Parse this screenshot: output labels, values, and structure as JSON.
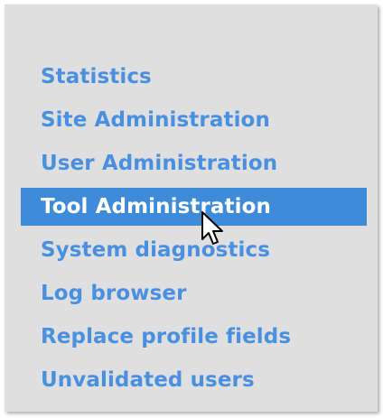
{
  "menu": {
    "items": [
      {
        "label": "Statistics",
        "active": false
      },
      {
        "label": "Site Administration",
        "active": false
      },
      {
        "label": "User Administration",
        "active": false
      },
      {
        "label": "Tool Administration",
        "active": true
      },
      {
        "label": "System diagnostics",
        "active": false
      },
      {
        "label": "Log browser",
        "active": false
      },
      {
        "label": "Replace profile fields",
        "active": false
      },
      {
        "label": "Unvalidated users",
        "active": false
      }
    ]
  },
  "colors": {
    "panel_bg": "#dfdfdf",
    "link": "#4a90e2",
    "active_bg": "#3d8bd9",
    "active_text": "#ffffff"
  },
  "icons": {
    "cursor": "mouse-pointer-icon"
  }
}
